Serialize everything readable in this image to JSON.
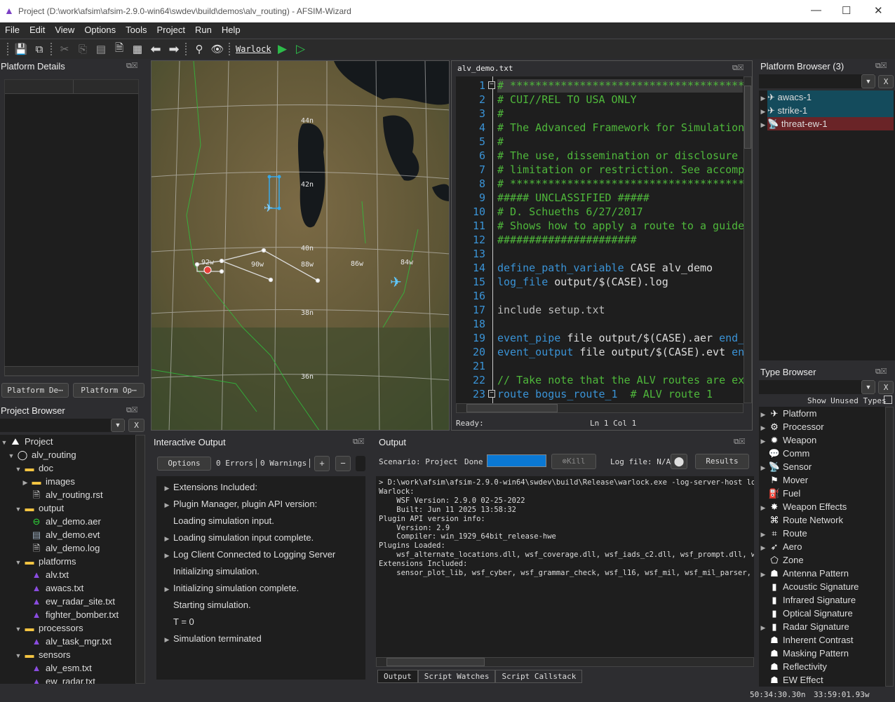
{
  "window": {
    "title": "Project (D:\\work\\afsim\\afsim-2.9.0-win64\\swdev\\build\\demos\\alv_routing) - AFSIM-Wizard",
    "minimize": "—",
    "maximize": "☐",
    "close": "✕"
  },
  "menu": [
    "File",
    "Edit",
    "View",
    "Options",
    "Tools",
    "Project",
    "Run",
    "Help"
  ],
  "toolbar": {
    "warlock_label": "Warlock"
  },
  "platform_details": {
    "title": "Platform Details",
    "tabs": [
      "Platform De⋯",
      "Platform Op⋯"
    ]
  },
  "project_browser": {
    "title": "Project Browser",
    "clear": "X",
    "items": [
      {
        "label": "Project",
        "depth": 0,
        "arrow": "down",
        "icon": "project"
      },
      {
        "label": "alv_routing",
        "depth": 1,
        "arrow": "down",
        "icon": "circle-folder"
      },
      {
        "label": "doc",
        "depth": 2,
        "arrow": "down",
        "icon": "folder"
      },
      {
        "label": "images",
        "depth": 3,
        "arrow": "right",
        "icon": "folder"
      },
      {
        "label": "alv_routing.rst",
        "depth": 3,
        "arrow": "",
        "icon": "file"
      },
      {
        "label": "output",
        "depth": 2,
        "arrow": "down",
        "icon": "folder"
      },
      {
        "label": "alv_demo.aer",
        "depth": 3,
        "arrow": "",
        "icon": "aer"
      },
      {
        "label": "alv_demo.evt",
        "depth": 3,
        "arrow": "",
        "icon": "evt"
      },
      {
        "label": "alv_demo.log",
        "depth": 3,
        "arrow": "",
        "icon": "file"
      },
      {
        "label": "platforms",
        "depth": 2,
        "arrow": "down",
        "icon": "folder"
      },
      {
        "label": "alv.txt",
        "depth": 3,
        "arrow": "",
        "icon": "wizard"
      },
      {
        "label": "awacs.txt",
        "depth": 3,
        "arrow": "",
        "icon": "wizard"
      },
      {
        "label": "ew_radar_site.txt",
        "depth": 3,
        "arrow": "",
        "icon": "wizard"
      },
      {
        "label": "fighter_bomber.txt",
        "depth": 3,
        "arrow": "",
        "icon": "wizard"
      },
      {
        "label": "processors",
        "depth": 2,
        "arrow": "down",
        "icon": "folder"
      },
      {
        "label": "alv_task_mgr.txt",
        "depth": 3,
        "arrow": "",
        "icon": "wizard"
      },
      {
        "label": "sensors",
        "depth": 2,
        "arrow": "down",
        "icon": "folder"
      },
      {
        "label": "alv_esm.txt",
        "depth": 3,
        "arrow": "",
        "icon": "wizard"
      },
      {
        "label": "ew_radar.txt",
        "depth": 3,
        "arrow": "",
        "icon": "wizard"
      }
    ]
  },
  "map": {
    "lat_labels": [
      "44n",
      "42n",
      "40n",
      "38n",
      "36n"
    ],
    "lon_labels": [
      "92w",
      "90w",
      "88w",
      "86w",
      "84w"
    ]
  },
  "editor": {
    "tab": "alv_demo.txt",
    "status": "Ready:",
    "position": "Ln 1 Col 1",
    "lines": [
      [
        [
          "# ****************************************",
          "c"
        ]
      ],
      [
        [
          "# CUI//REL TO USA ONLY",
          "c"
        ]
      ],
      [
        [
          "#",
          "c"
        ]
      ],
      [
        [
          "# The Advanced Framework for Simulation",
          "c"
        ]
      ],
      [
        [
          "#",
          "c"
        ]
      ],
      [
        [
          "# The use, dissemination or disclosure",
          "c"
        ]
      ],
      [
        [
          "# limitation or restriction. See accomp",
          "c"
        ]
      ],
      [
        [
          "# ****************************************",
          "c"
        ]
      ],
      [
        [
          "##### UNCLASSIFIED #####",
          "c"
        ]
      ],
      [
        [
          "# D. Schueths 6/27/2017",
          "c"
        ]
      ],
      [
        [
          "# Shows how to apply a route to a guide",
          "c"
        ]
      ],
      [
        [
          "######################",
          "c"
        ]
      ],
      [],
      [
        [
          "define_path_variable",
          "k"
        ],
        [
          " CASE alv_demo",
          "n"
        ]
      ],
      [
        [
          "log_file",
          "k"
        ],
        [
          " output/$(CASE).log",
          "n"
        ]
      ],
      [],
      [
        [
          "include setup.txt",
          "p"
        ]
      ],
      [],
      [
        [
          "event_pipe",
          "k"
        ],
        [
          " file output/$(CASE).aer ",
          "n"
        ],
        [
          "end_",
          "k"
        ]
      ],
      [
        [
          "event_output",
          "k"
        ],
        [
          " file output/$(CASE).evt ",
          "n"
        ],
        [
          "en",
          "k"
        ]
      ],
      [],
      [
        [
          "// Take note that the ALV routes are ex",
          "c"
        ]
      ],
      [
        [
          "route",
          "k"
        ],
        [
          " bogus_route_1",
          "k"
        ],
        [
          "  # ALV route 1",
          "c"
        ]
      ]
    ]
  },
  "platform_browser": {
    "title": "Platform Browser (3)",
    "clear": "X",
    "items": [
      {
        "label": "awacs-1",
        "icon": "airplane",
        "color": "#144b5c"
      },
      {
        "label": "strike-1",
        "icon": "airplane",
        "color": "#144b5c"
      },
      {
        "label": "threat-ew-1",
        "icon": "radar",
        "color": "#6a2427"
      }
    ]
  },
  "type_browser": {
    "title": "Type Browser",
    "clear": "X",
    "show_unused": "Show Unused Types",
    "items": [
      {
        "label": "Platform",
        "arrow": true,
        "icon": "✈"
      },
      {
        "label": "Processor",
        "arrow": true,
        "icon": "⚙"
      },
      {
        "label": "Weapon",
        "arrow": true,
        "icon": "✹"
      },
      {
        "label": "Comm",
        "arrow": false,
        "icon": "💬"
      },
      {
        "label": "Sensor",
        "arrow": true,
        "icon": "📡"
      },
      {
        "label": "Mover",
        "arrow": false,
        "icon": "⚑"
      },
      {
        "label": "Fuel",
        "arrow": false,
        "icon": "⛽"
      },
      {
        "label": "Weapon Effects",
        "arrow": true,
        "icon": "✸"
      },
      {
        "label": "Route Network",
        "arrow": false,
        "icon": "⌘"
      },
      {
        "label": "Route",
        "arrow": true,
        "icon": "⌗"
      },
      {
        "label": "Aero",
        "arrow": true,
        "icon": "➶"
      },
      {
        "label": "Zone",
        "arrow": false,
        "icon": "⬠"
      },
      {
        "label": "Antenna Pattern",
        "arrow": true,
        "icon": "☗"
      },
      {
        "label": "Acoustic Signature",
        "arrow": false,
        "icon": "▮"
      },
      {
        "label": "Infrared Signature",
        "arrow": false,
        "icon": "▮"
      },
      {
        "label": "Optical Signature",
        "arrow": false,
        "icon": "▮"
      },
      {
        "label": "Radar Signature",
        "arrow": true,
        "icon": "▮"
      },
      {
        "label": "Inherent Contrast",
        "arrow": false,
        "icon": "☗"
      },
      {
        "label": "Masking Pattern",
        "arrow": false,
        "icon": "☗"
      },
      {
        "label": "Reflectivity",
        "arrow": false,
        "icon": "☗"
      },
      {
        "label": "EW Effect",
        "arrow": false,
        "icon": "☗"
      }
    ]
  },
  "interactive_output": {
    "title": "Interactive Output",
    "options": "Options",
    "errors": "0 Errors",
    "warnings": "0 Warnings",
    "plus": "+",
    "minus": "−",
    "items": [
      {
        "label": "Extensions Included:",
        "arrow": true
      },
      {
        "label": "Plugin Manager, plugin API version:",
        "arrow": true
      },
      {
        "label": "Loading simulation input.",
        "arrow": false
      },
      {
        "label": "Loading simulation input complete.",
        "arrow": true
      },
      {
        "label": "Log Client Connected to Logging Server",
        "arrow": true
      },
      {
        "label": "Initializing simulation.",
        "arrow": false
      },
      {
        "label": "Initializing simulation complete.",
        "arrow": true
      },
      {
        "label": "Starting simulation.",
        "arrow": false
      },
      {
        "label": "T = 0",
        "arrow": false
      },
      {
        "label": "Simulation terminated",
        "arrow": true
      }
    ]
  },
  "output": {
    "title": "Output",
    "scenario": "Scenario: Project",
    "state": "Done",
    "progress": 1.0,
    "kill": "Kill",
    "log_file": "Log file: N/A",
    "results": "Results",
    "lines": [
      "> D:\\work\\afsim\\afsim-2.9.0-win64\\swdev\\build\\Release\\warlock.exe -log-server-host localh",
      "Warlock:",
      "    WSF Version: 2.9.0 02-25-2022",
      "    Built: Jun 11 2025 13:58:32",
      "Plugin API version info:",
      "    Version: 2.9",
      "    Compiler: win_1929_64bit_release-hwe",
      "Plugins Loaded:",
      "    wsf_alternate_locations.dll, wsf_coverage.dll, wsf_iads_c2.dll, wsf_prompt.dll, wsf_s",
      "Extensions Included:",
      "    sensor_plot_lib, wsf_cyber, wsf_grammar_check, wsf_l16, wsf_mil, wsf_mil_parser, wsf_"
    ],
    "tabs": [
      "Output",
      "Script Watches",
      "Script Callstack"
    ]
  },
  "statusbar": {
    "lat": "50:34:30.30n",
    "lon": "33:59:01.93w"
  }
}
